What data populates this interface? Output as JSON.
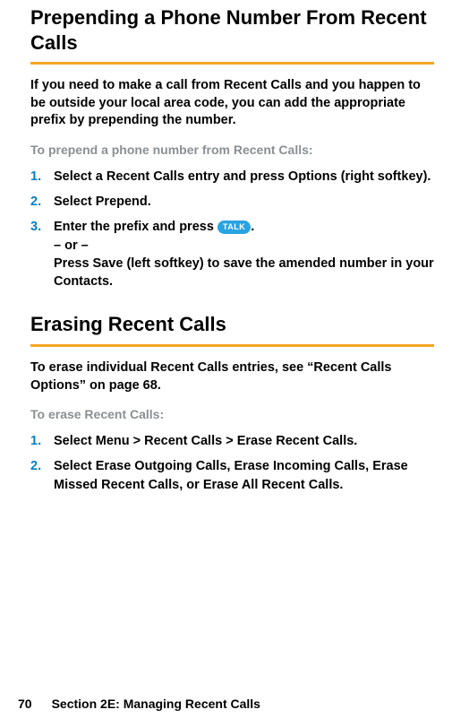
{
  "section1": {
    "heading": "Prepending a Phone Number From Recent Calls",
    "intro": "If you need to make a call from Recent Calls and you happen to be outside your local area code, you can add the appropriate prefix by prepending the number.",
    "lead": "To prepend a phone number from Recent Calls:",
    "step1": {
      "num": "1.",
      "a": "Select a Recent Calls entry and press ",
      "b": "Options",
      "c": " (right softkey)."
    },
    "step2": {
      "num": "2.",
      "a": "Select ",
      "b": "Prepend",
      "c": "."
    },
    "step3": {
      "num": "3.",
      "a": "Enter the prefix and press ",
      "talk": "TALK",
      "b": ".",
      "or": "– or –",
      "c": "Press ",
      "d": "Save",
      "e": " (left softkey) to save the amended number in your Contacts."
    }
  },
  "section2": {
    "heading": "Erasing Recent Calls",
    "intro": "To erase individual Recent Calls entries, see “Recent Calls Options” on page 68.",
    "lead": "To erase Recent Calls:",
    "step1": {
      "num": "1.",
      "a": "Select ",
      "b": "Menu",
      "sep1": " > ",
      "c": "Recent Calls",
      "sep2": " > ",
      "d": "Erase Recent Calls",
      "e": "."
    },
    "step2": {
      "num": "2.",
      "a": "Select ",
      "b": "Erase Outgoing Calls",
      "c": ", ",
      "d": "Erase Incoming Calls",
      "e": ", ",
      "f": "Erase Missed Recent Calls",
      "g": ", or ",
      "h": "Erase All Recent Calls",
      "i": "."
    }
  },
  "footer": {
    "page": "70",
    "section": "Section 2E: Managing Recent Calls"
  }
}
